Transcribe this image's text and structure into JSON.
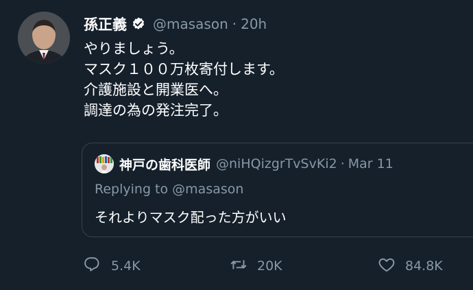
{
  "tweet": {
    "author_name": "孫正義",
    "handle": "@masason",
    "separator": "·",
    "time": "20h",
    "lines": [
      "やりましょう。",
      "マスク１００万枚寄付します。",
      "介護施設と開業医へ。",
      "調達の為の発注完了。"
    ],
    "verified_icon": "verified-badge-icon"
  },
  "quote": {
    "author_name": "神戸の歯科医師",
    "handle": "@niHQizgrTvSvKi2",
    "separator": "·",
    "date": "Mar 11",
    "replying_prefix": "Replying to",
    "replying_handle": "@masason",
    "text": "それよりマスク配った方がいい"
  },
  "actions": {
    "reply_count": "5.4K",
    "retweet_count": "20K",
    "like_count": "84.8K"
  },
  "colors": {
    "background": "#15202b",
    "secondary_text": "#8899a6",
    "border": "#38444d"
  }
}
